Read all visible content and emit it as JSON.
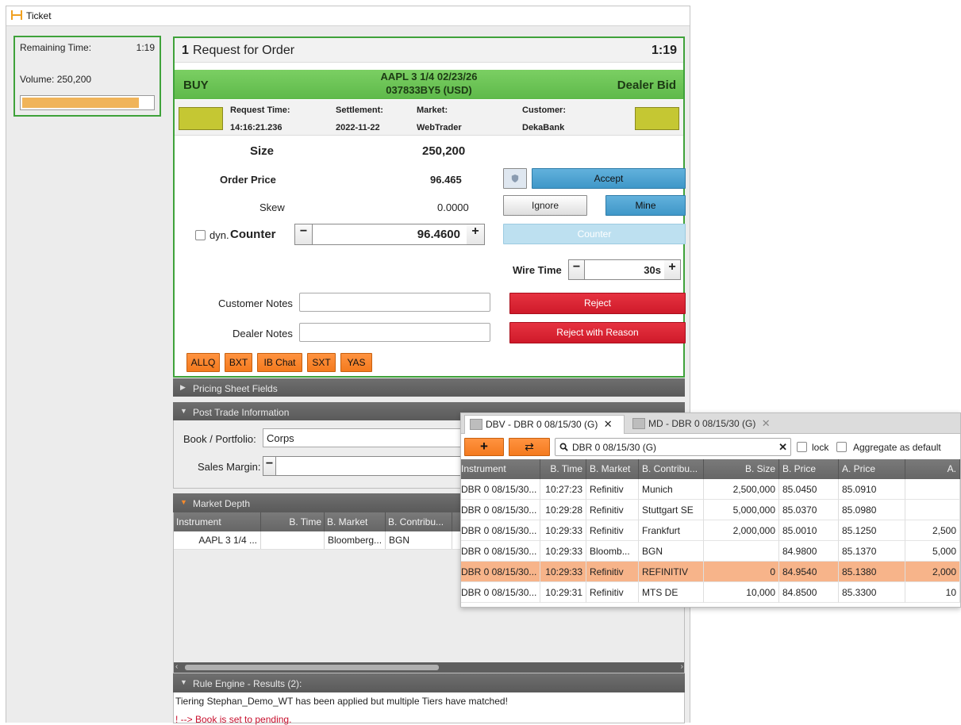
{
  "window": {
    "title": "Ticket"
  },
  "timer": {
    "remaining_label": "Remaining Time:",
    "remaining_value": "1:19",
    "volume_label": "Volume: 250,200",
    "progress": 0.9
  },
  "rfq": {
    "number": "1",
    "title": "Request for Order",
    "time": "1:19",
    "side": "BUY",
    "security_line1": "AAPL 3 1/4 02/23/26",
    "security_line2": "037833BY5 (USD)",
    "bid_label": "Dealer Bid",
    "info": [
      {
        "label": "Request Time:",
        "value": "14:16:21.236"
      },
      {
        "label": "Settlement:",
        "value": "2022-11-22"
      },
      {
        "label": "Market:",
        "value": "WebTrader"
      },
      {
        "label": "Customer:",
        "value": "DekaBank"
      }
    ],
    "swatch_color": "#c5c733",
    "size_label": "Size",
    "size_value": "250,200",
    "order_price_label": "Order Price",
    "order_price_value": "96.465",
    "skew_label": "Skew",
    "skew_value": "0.0000",
    "dyn_label": "dyn.",
    "counter_label": "Counter",
    "counter_value": "96.4600",
    "accept_label": "Accept",
    "ignore_label": "Ignore",
    "mine_label": "Mine",
    "counter_button_label": "Counter",
    "wire_time_label": "Wire Time",
    "wire_time_value": "30s",
    "customer_notes_label": "Customer Notes",
    "dealer_notes_label": "Dealer Notes",
    "reject_label": "Reject",
    "reject_reason_label": "Reject with Reason",
    "quick_buttons": [
      "ALLQ",
      "BXT",
      "IB Chat",
      "SXT",
      "YAS"
    ]
  },
  "sections": {
    "pricing_sheet": "Pricing Sheet Fields",
    "post_trade": "Post Trade Information",
    "book_label": "Book / Portfolio:",
    "book_value": "Corps",
    "sales_margin_label": "Sales Margin:",
    "market_depth": "Market Depth",
    "rule_engine": "Rule Engine - Results (2):",
    "rule_line1": "Tiering Stephan_Demo_WT has been applied but multiple Tiers have matched!",
    "rule_line2": "! --> Book is set to pending."
  },
  "market_depth": {
    "headers": [
      "Instrument",
      "B. Time",
      "B. Market",
      "B. Contribu..."
    ],
    "row": [
      "AAPL 3 1/4 ...",
      "",
      "Bloomberg...",
      "BGN"
    ]
  },
  "floating": {
    "tab1": "DBV - DBR 0 08/15/30 (G)",
    "tab2": "MD - DBR 0 08/15/30 (G)",
    "search_value": "DBR 0 08/15/30 (G)",
    "lock_label": "lock",
    "aggregate_label": "Aggregate as default",
    "headers": [
      "Instrument",
      "B. Time",
      "B. Market",
      "B. Contribu...",
      "B. Size",
      "B. Price",
      "A. Price",
      "A."
    ],
    "rows": [
      [
        "DBR 0 08/15/30...",
        "10:27:23",
        "Refinitiv",
        "Munich",
        "2,500,000",
        "85.0450",
        "85.0910",
        ""
      ],
      [
        "DBR 0 08/15/30...",
        "10:29:28",
        "Refinitiv",
        "Stuttgart SE",
        "5,000,000",
        "85.0370",
        "85.0980",
        ""
      ],
      [
        "DBR 0 08/15/30...",
        "10:29:33",
        "Refinitiv",
        "Frankfurt",
        "2,000,000",
        "85.0010",
        "85.1250",
        "2,500"
      ],
      [
        "DBR 0 08/15/30...",
        "10:29:33",
        "Bloomb...",
        "BGN",
        "",
        "84.9800",
        "85.1370",
        "5,000"
      ],
      [
        "DBR 0 08/15/30...",
        "10:29:33",
        "Refinitiv",
        "REFINITIV",
        "0",
        "84.9540",
        "85.1380",
        "2,000"
      ],
      [
        "DBR 0 08/15/30...",
        "10:29:31",
        "Refinitiv",
        "MTS DE",
        "10,000",
        "84.8500",
        "85.3300",
        "10"
      ]
    ],
    "highlight_row": 4,
    "highlight_color": "#f7b48a"
  }
}
